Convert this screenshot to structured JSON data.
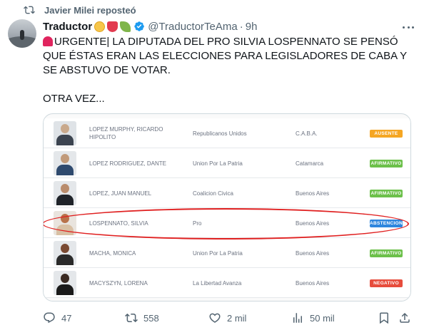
{
  "repost": {
    "text": "Javier Milei reposteó",
    "icon": "repost-icon"
  },
  "author": {
    "name": "Traductor",
    "handle": "@TraductorTeAma",
    "dot": "·",
    "time": "9h"
  },
  "tweet": {
    "line1": "URGENTE| LA DIPUTADA DEL PRO SILVIA LOSPENNATO SE PENSÓ QUE ÉSTAS ERAN LAS ELECCIONES PARA LEGISLADORES DE CABA Y SE ABSTUVO DE VOTAR.",
    "line2": "OTRA VEZ..."
  },
  "table": {
    "rows": [
      {
        "name": "LOPEZ MURPHY, RICARDO HIPOLITO",
        "party": "Republicanos Unidos",
        "place": "C.A.B.A.",
        "vote": "AUSENTE",
        "vote_color": "#f5a623"
      },
      {
        "name": "LOPEZ RODRIGUEZ, DANTE",
        "party": "Union Por La Patria",
        "place": "Catamarca",
        "vote": "AFIRMATIVO",
        "vote_color": "#6cc04a"
      },
      {
        "name": "LOPEZ, JUAN MANUEL",
        "party": "Coalicion Civica",
        "place": "Buenos Aires",
        "vote": "AFIRMATIVO",
        "vote_color": "#6cc04a"
      },
      {
        "name": "LOSPENNATO, SILVIA",
        "party": "Pro",
        "place": "Buenos Aires",
        "vote": "ABSTENCION",
        "vote_color": "#2e86de"
      },
      {
        "name": "MACHA, MONICA",
        "party": "Union Por La Patria",
        "place": "Buenos Aires",
        "vote": "AFIRMATIVO",
        "vote_color": "#6cc04a"
      },
      {
        "name": "MACYSZYN, LORENA",
        "party": "La Libertad Avanza",
        "place": "Buenos Aires",
        "vote": "NEGATIVO",
        "vote_color": "#e74c3c"
      }
    ]
  },
  "actions": {
    "replies": "47",
    "reposts": "558",
    "likes": "2 mil",
    "views": "50 mil"
  },
  "colors": {
    "accent": "#1d9bf0",
    "muted": "#536471",
    "repost_green": "#00ba7c",
    "highlight_red": "#e02020"
  }
}
